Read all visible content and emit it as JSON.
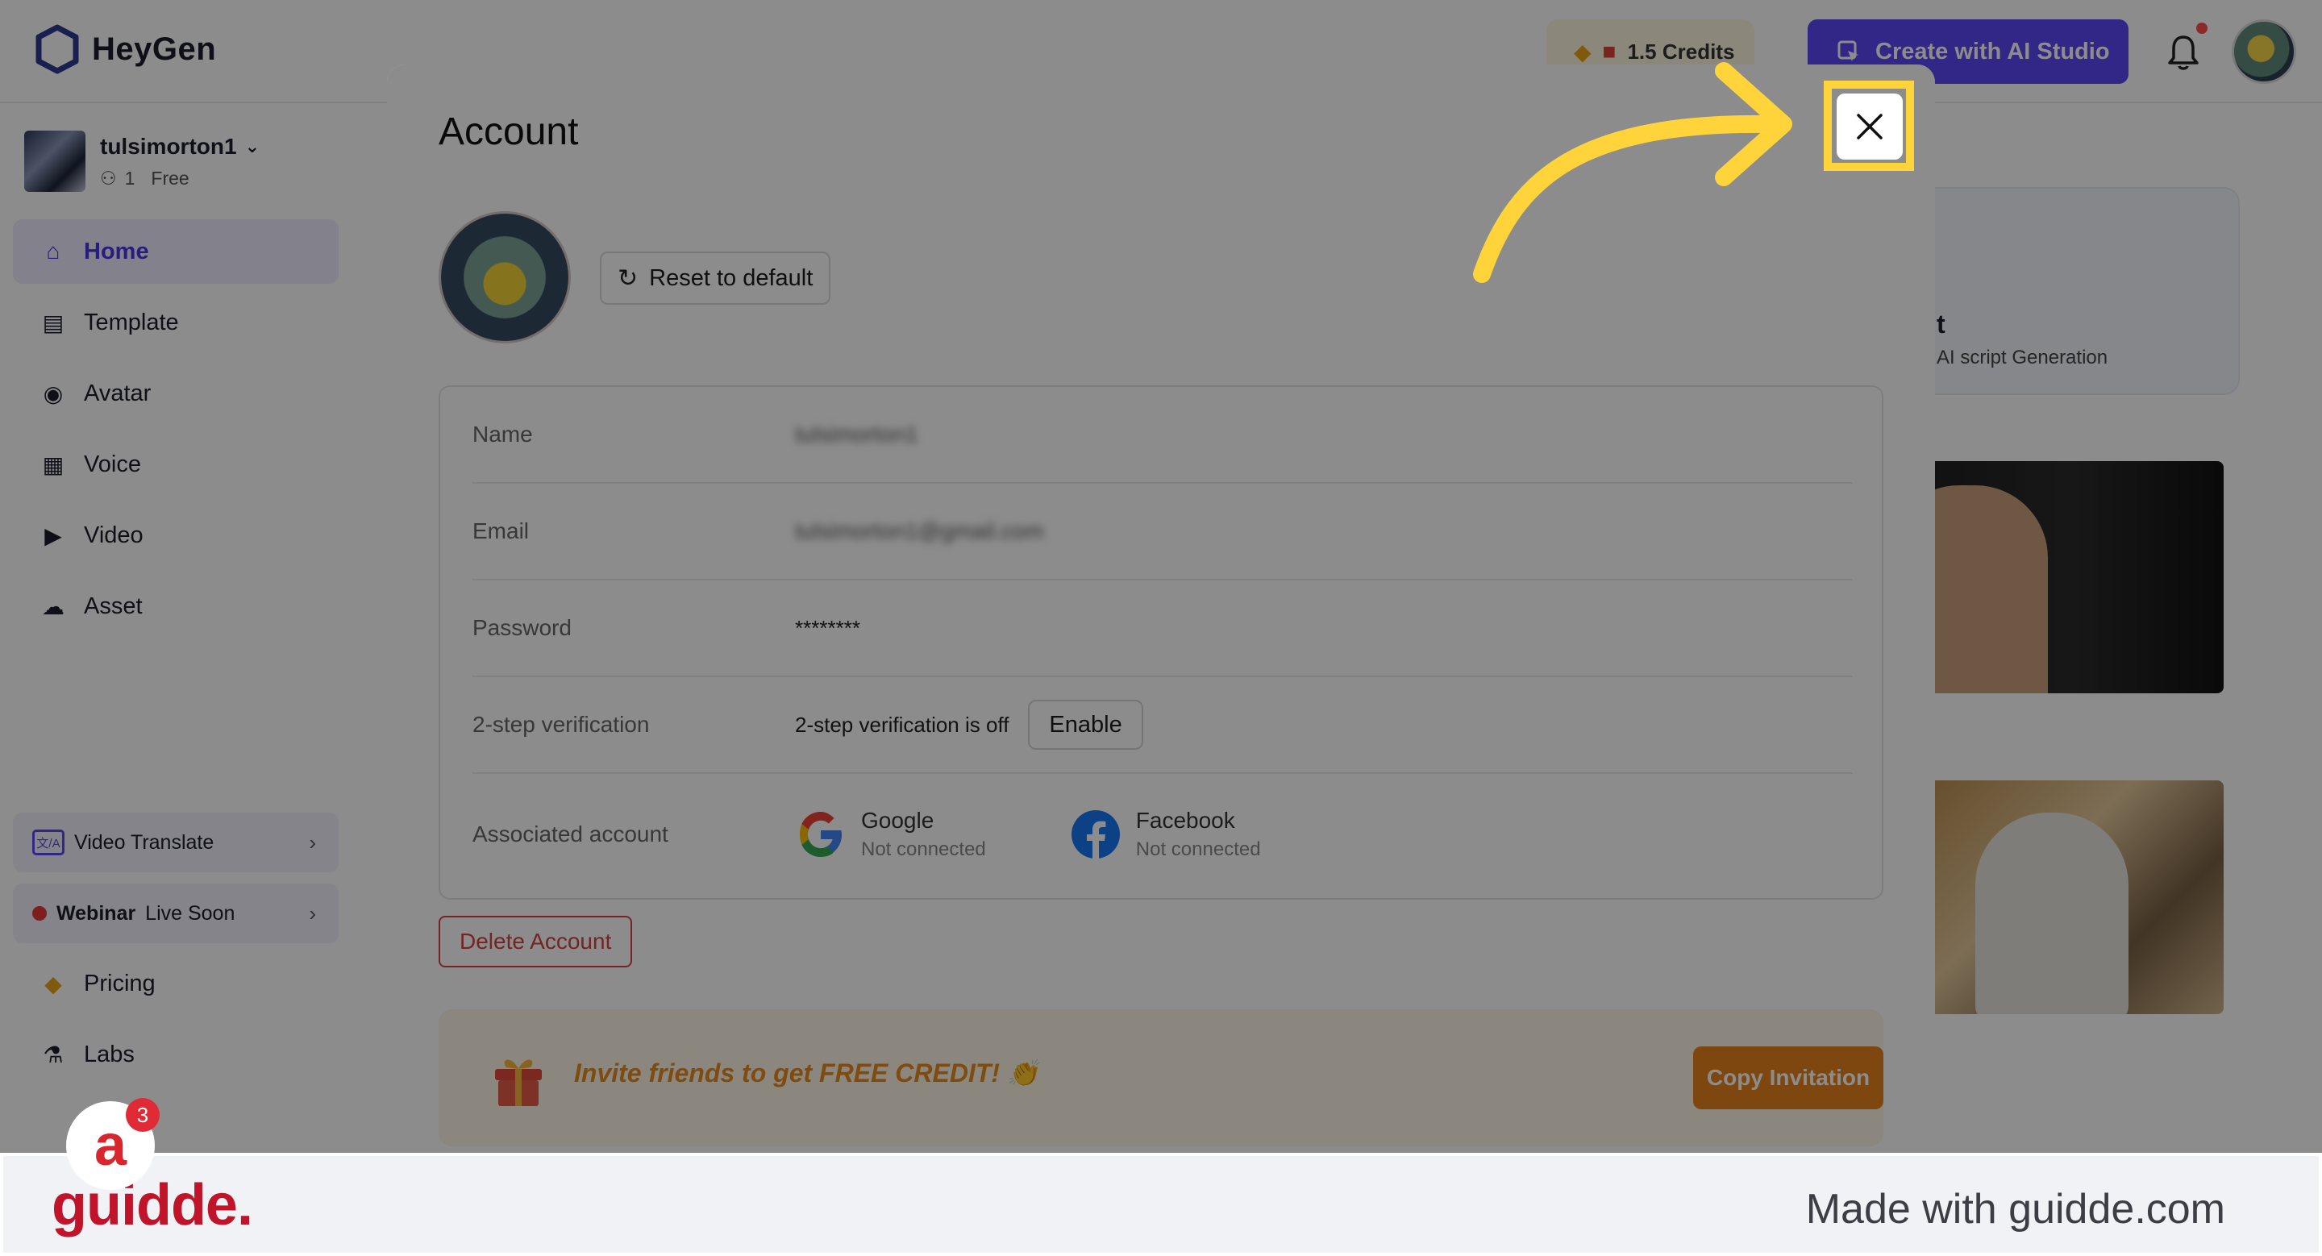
{
  "app": {
    "name": "HeyGen",
    "credits": "1.5 Credits",
    "create_button": "Create with AI Studio",
    "workspace": {
      "name": "tulsimorton1",
      "members": "1",
      "plan": "Free"
    },
    "nav": [
      {
        "label": "Home",
        "icon": "home-icon",
        "active": true
      },
      {
        "label": "Template",
        "icon": "template-icon"
      },
      {
        "label": "Avatar",
        "icon": "avatar-icon"
      },
      {
        "label": "Voice",
        "icon": "voice-icon"
      },
      {
        "label": "Video",
        "icon": "video-icon"
      },
      {
        "label": "Asset",
        "icon": "cloud-icon"
      }
    ],
    "promos": [
      {
        "label": "Video Translate"
      },
      {
        "bold": "Webinar",
        "label": "Live Soon"
      }
    ],
    "nav2": [
      {
        "label": "Pricing",
        "icon": "pricing-icon"
      },
      {
        "label": "Labs",
        "icon": "flask-icon"
      }
    ],
    "right_card": {
      "title": "t",
      "subtitle": "AI script Generation"
    },
    "chat_badge": "3"
  },
  "modal": {
    "title": "Account",
    "reset_button": "Reset to default",
    "rows": {
      "name": {
        "label": "Name",
        "value": "tulsimorton1"
      },
      "email": {
        "label": "Email",
        "value": "tulsimorton1@gmail.com"
      },
      "password": {
        "label": "Password",
        "value": "********"
      },
      "two_step": {
        "label": "2-step verification",
        "status": "2-step verification is off",
        "button": "Enable"
      },
      "associated": {
        "label": "Associated account",
        "google": {
          "name": "Google",
          "status": "Not connected"
        },
        "facebook": {
          "name": "Facebook",
          "status": "Not connected"
        }
      }
    },
    "delete_button": "Delete Account",
    "invite": {
      "text": "Invite friends to get FREE CREDIT! 👏",
      "button": "Copy Invitation"
    }
  },
  "footer": {
    "brand": "guidde.",
    "made_with": "Made with guidde.com"
  },
  "colors": {
    "accent": "#5b45f5",
    "highlight": "#ffd43b",
    "brand_red": "#c0142a",
    "invite_orange": "#e6821c"
  }
}
